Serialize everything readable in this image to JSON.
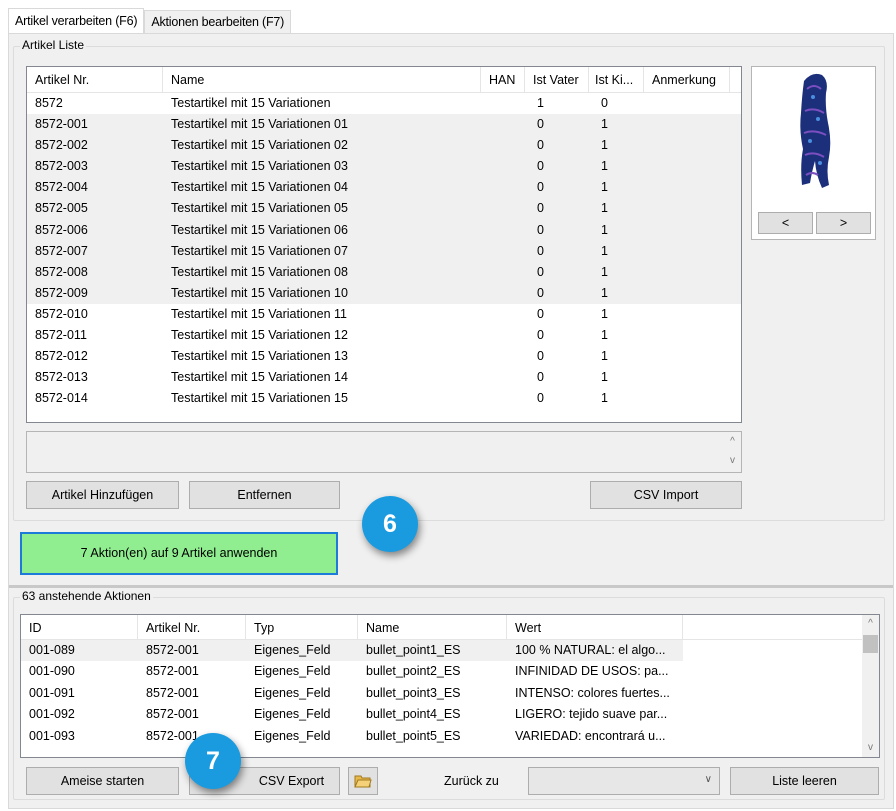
{
  "tabs": [
    {
      "label": "Artikel verarbeiten (F6)"
    },
    {
      "label": "Aktionen bearbeiten (F7)"
    }
  ],
  "article_list": {
    "legend": "Artikel Liste",
    "columns": [
      "Artikel Nr.",
      "Name",
      "HAN",
      "Ist Vater",
      "Ist Ki...",
      "Anmerkung"
    ],
    "rows": [
      {
        "nr": "8572",
        "name": "Testartikel mit 15 Variationen",
        "han": "",
        "vater": "1",
        "kind": "0",
        "note": ""
      },
      {
        "nr": "8572-001",
        "name": "Testartikel mit 15 Variationen 01",
        "han": "",
        "vater": "0",
        "kind": "1",
        "note": ""
      },
      {
        "nr": "8572-002",
        "name": "Testartikel mit 15 Variationen 02",
        "han": "",
        "vater": "0",
        "kind": "1",
        "note": ""
      },
      {
        "nr": "8572-003",
        "name": "Testartikel mit 15 Variationen 03",
        "han": "",
        "vater": "0",
        "kind": "1",
        "note": ""
      },
      {
        "nr": "8572-004",
        "name": "Testartikel mit 15 Variationen 04",
        "han": "",
        "vater": "0",
        "kind": "1",
        "note": ""
      },
      {
        "nr": "8572-005",
        "name": "Testartikel mit 15 Variationen 05",
        "han": "",
        "vater": "0",
        "kind": "1",
        "note": ""
      },
      {
        "nr": "8572-006",
        "name": "Testartikel mit 15 Variationen 06",
        "han": "",
        "vater": "0",
        "kind": "1",
        "note": ""
      },
      {
        "nr": "8572-007",
        "name": "Testartikel mit 15 Variationen 07",
        "han": "",
        "vater": "0",
        "kind": "1",
        "note": ""
      },
      {
        "nr": "8572-008",
        "name": "Testartikel mit 15 Variationen 08",
        "han": "",
        "vater": "0",
        "kind": "1",
        "note": ""
      },
      {
        "nr": "8572-009",
        "name": "Testartikel mit 15 Variationen 10",
        "han": "",
        "vater": "0",
        "kind": "1",
        "note": ""
      },
      {
        "nr": "8572-010",
        "name": "Testartikel mit 15 Variationen 11",
        "han": "",
        "vater": "0",
        "kind": "1",
        "note": ""
      },
      {
        "nr": "8572-011",
        "name": "Testartikel mit 15 Variationen 12",
        "han": "",
        "vater": "0",
        "kind": "1",
        "note": ""
      },
      {
        "nr": "8572-012",
        "name": "Testartikel mit 15 Variationen 13",
        "han": "",
        "vater": "0",
        "kind": "1",
        "note": ""
      },
      {
        "nr": "8572-013",
        "name": "Testartikel mit 15 Variationen 14",
        "han": "",
        "vater": "0",
        "kind": "1",
        "note": ""
      },
      {
        "nr": "8572-014",
        "name": "Testartikel mit 15 Variationen 15",
        "han": "",
        "vater": "0",
        "kind": "1",
        "note": ""
      }
    ],
    "shaded_rows": [
      1,
      2,
      3,
      4,
      5,
      6,
      7,
      8,
      9
    ]
  },
  "image_nav": {
    "prev": "<",
    "next": ">"
  },
  "buttons": {
    "add_article": "Artikel Hinzufügen",
    "remove": "Entfernen",
    "csv_import": "CSV Import",
    "apply": "7  Aktion(en) auf 9 Artikel anwenden",
    "start_ant": "Ameise starten",
    "csv_export": "CSV Export",
    "clear_list": "Liste leeren"
  },
  "pending": {
    "legend": "63 anstehende Aktionen",
    "columns": [
      "ID",
      "Artikel Nr.",
      "Typ",
      "Name",
      "Wert"
    ],
    "rows": [
      {
        "id": "001-089",
        "nr": "8572-001",
        "typ": "Eigenes_Feld",
        "name": "bullet_point1_ES",
        "wert": "100 % NATURAL: el algo..."
      },
      {
        "id": "001-090",
        "nr": "8572-001",
        "typ": "Eigenes_Feld",
        "name": "bullet_point2_ES",
        "wert": "INFINIDAD DE USOS: pa..."
      },
      {
        "id": "001-091",
        "nr": "8572-001",
        "typ": "Eigenes_Feld",
        "name": "bullet_point3_ES",
        "wert": "INTENSO: colores fuertes..."
      },
      {
        "id": "001-092",
        "nr": "8572-001",
        "typ": "Eigenes_Feld",
        "name": "bullet_point4_ES",
        "wert": "LIGERO: tejido suave par..."
      },
      {
        "id": "001-093",
        "nr": "8572-001",
        "typ": "Eigenes_Feld",
        "name": "bullet_point5_ES",
        "wert": "VARIEDAD: encontrará u..."
      }
    ]
  },
  "back_to": {
    "label": "Zurück zu",
    "value": ""
  },
  "badges": {
    "b6": "6",
    "b7": "7"
  },
  "colors": {
    "apply_bg": "#90ee90",
    "apply_border": "#1e7ad8",
    "badge": "#1a9be0"
  }
}
